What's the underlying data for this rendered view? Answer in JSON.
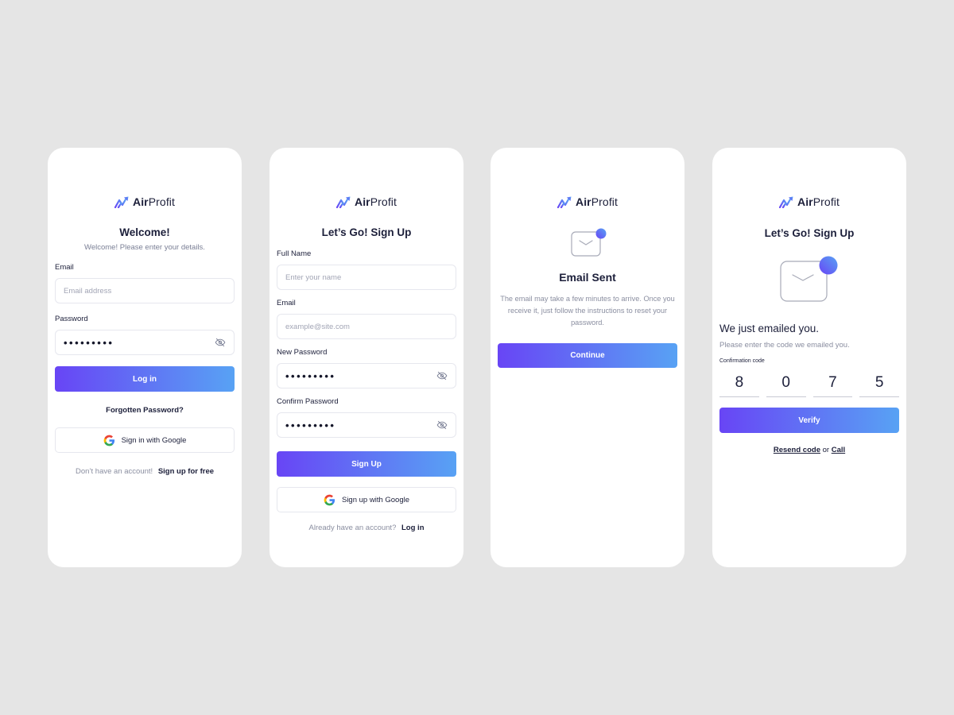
{
  "brand": {
    "name_bold": "Air",
    "name_rest": "Profit",
    "icon": "chart-up-logo-icon"
  },
  "colors": {
    "accent_start": "#6845f5",
    "accent_end": "#58a2f4",
    "text": "#1c1f3a",
    "muted": "#7a7f95",
    "background": "#e5e5e5"
  },
  "login": {
    "title": "Welcome!",
    "subtitle": "Welcome! Please enter your details.",
    "email_label": "Email",
    "email_placeholder": "Email address",
    "password_label": "Password",
    "password_value": "•••••••••",
    "login_button": "Log in",
    "forgot": "Forgotten Password?",
    "google_button": "Sign in with Google",
    "footer_text": "Don’t have an account!",
    "footer_link": "Sign up for free"
  },
  "signup": {
    "title": "Let’s Go! Sign Up",
    "fullname_label": "Full Name",
    "fullname_placeholder": "Enter your name",
    "email_label": "Email",
    "email_placeholder": "example@site.com",
    "new_password_label": "New Password",
    "new_password_value": "•••••••••",
    "confirm_password_label": "Confirm Password",
    "confirm_password_value": "•••••••••",
    "signup_button": "Sign Up",
    "google_button": "Sign up with Google",
    "footer_text": "Already have an account?",
    "footer_link": "Log in"
  },
  "email_sent": {
    "title": "Email Sent",
    "description": "The email may take a few minutes to arrive. Once you receive it, just follow the instructions to reset your password.",
    "continue_button": "Continue"
  },
  "verify": {
    "title": "Let’s Go! Sign Up",
    "heading": "We just emailed you.",
    "subtext": "Please enter the code we emailed you.",
    "code_label": "Confirmation code",
    "code": [
      "8",
      "0",
      "7",
      "5"
    ],
    "verify_button": "Verify",
    "resend_link": "Resend code",
    "or_text": "or",
    "call_link": "Call"
  }
}
